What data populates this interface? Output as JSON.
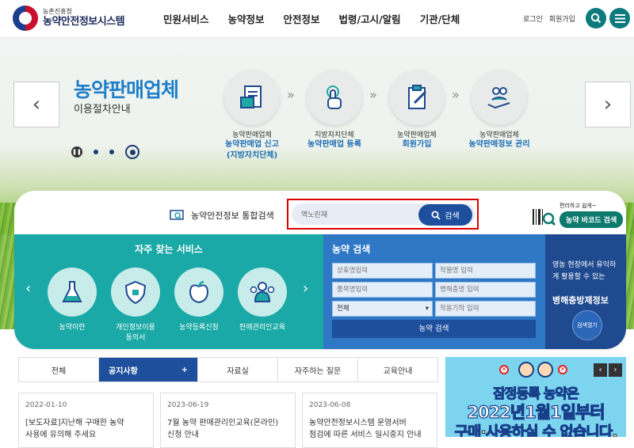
{
  "header": {
    "logo_sub": "농촌진흥청",
    "logo_main": "농약안전정보시스템",
    "nav": [
      "민원서비스",
      "농약정보",
      "안전정보",
      "법령/고시/알림",
      "기관/단체"
    ],
    "login": "로그인",
    "signup": "회원가입"
  },
  "hero": {
    "title": "농약판매업체",
    "subtitle": "이용절차안내",
    "steps": [
      {
        "small": "농약판매업체",
        "main": "농약판매업 신고",
        "main2": "(지방자치단체)"
      },
      {
        "small": "지방자치단체",
        "main": "농약판매업 등록",
        "main2": ""
      },
      {
        "small": "농약판매업체",
        "main": "회원가입",
        "main2": ""
      },
      {
        "small": "농약판매업체",
        "main": "농약판매정보 관리",
        "main2": ""
      }
    ]
  },
  "search": {
    "label": "농약안전정보 통합검색",
    "value": "멱노린재",
    "button": "검색",
    "barcode_tag": "편리하고 쉽게~",
    "barcode_button": "농약 바코드 검색"
  },
  "frequent": {
    "title": "자주 찾는 서비스",
    "items": [
      {
        "label": "농약이란",
        "label2": ""
      },
      {
        "label": "개인정보이용",
        "label2": "동의서"
      },
      {
        "label": "농약등록신청",
        "label2": ""
      },
      {
        "label": "판매관리인교육",
        "label2": ""
      }
    ]
  },
  "pesticide_search": {
    "title": "농약 검색",
    "fields": [
      "상표명입력",
      "작물명 입력",
      "품목명입력",
      "병해충명 입력",
      "전체",
      "작용기작 입력"
    ],
    "button": "농약 검색"
  },
  "pest_info": {
    "line1": "영농 현장에서 유익하",
    "line2": "게 활용할 수 있는",
    "title": "병해충방제정보",
    "button": "검색열기"
  },
  "tabs": [
    "전체",
    "공지사항",
    "자료실",
    "자주하는 질문",
    "교육안내"
  ],
  "tab_plus": "+",
  "news": [
    {
      "date": "2022-01-10",
      "title1": "[보도자료]지난해 구매한 농약",
      "title2": "사용에 유의해 주세요"
    },
    {
      "date": "2023-06-19",
      "title1": "7월 농약 판매관리인교육(온라인)",
      "title2": "신청 안내"
    },
    {
      "date": "2023-06-08",
      "title1": "농약안전정보시스템 운영서버",
      "title2": "점검에 따른 서비스 일시중지 안내"
    }
  ],
  "banner": {
    "line1": "잠정등록 농약은",
    "line2": "2022년1월1일부터",
    "line3": "구매·사용하실 수 없습니다."
  },
  "colors": {
    "teal": "#1aa9a6",
    "blue": "#2e78c6",
    "navy": "#1f4a8f",
    "accent": "#1d4f9c"
  }
}
